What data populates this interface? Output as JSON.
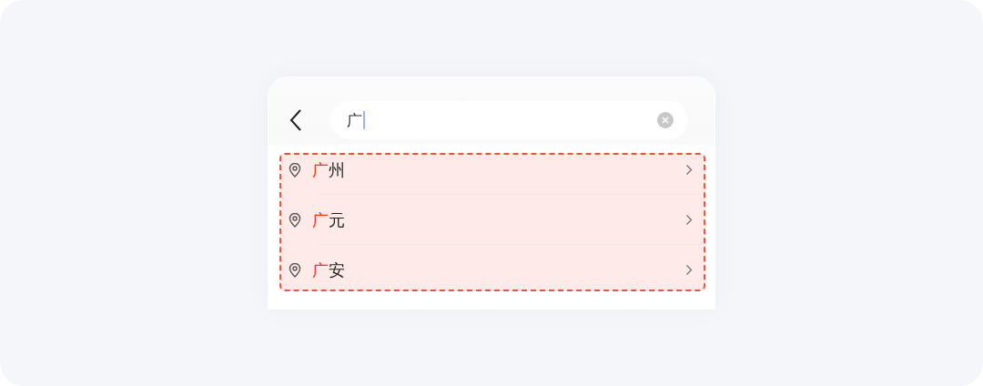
{
  "search": {
    "value": "广",
    "focused": true
  },
  "results": {
    "highlighted": true,
    "items": [
      {
        "match": "广",
        "rest": "州"
      },
      {
        "match": "广",
        "rest": "元"
      },
      {
        "match": "广",
        "rest": "安"
      }
    ]
  }
}
